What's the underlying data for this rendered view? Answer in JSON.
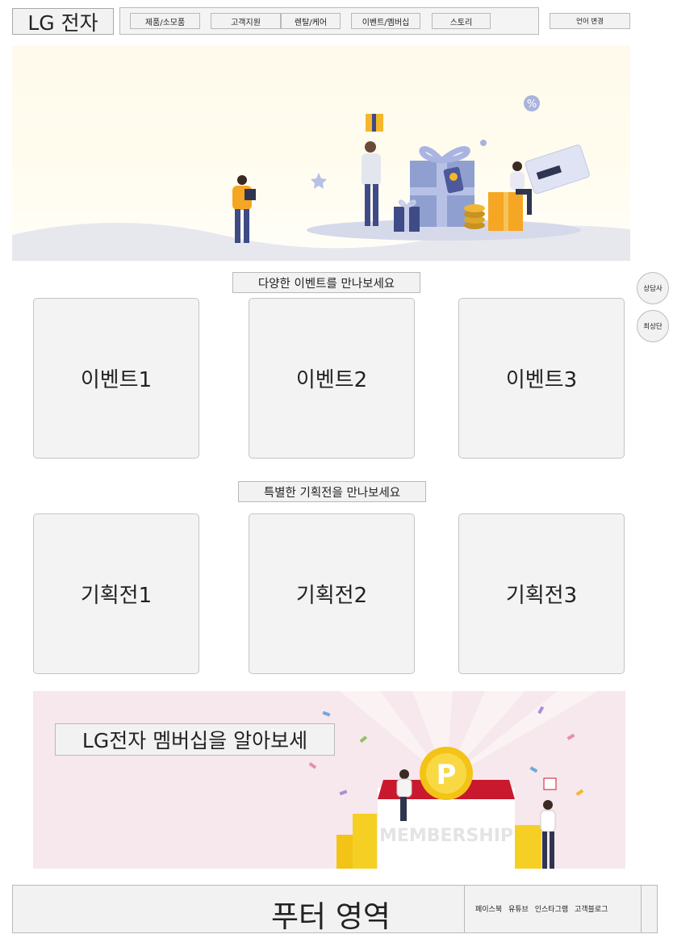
{
  "header": {
    "logo": "LG 전자",
    "nav": [
      "제품/소모품",
      "고객지원",
      "렌탈/케어",
      "이벤트/멤버십",
      "스토리"
    ],
    "language_button": "언어 변경"
  },
  "hero": {
    "image": "gift-event-illustration"
  },
  "floating": {
    "consult": "상담사",
    "top": "최상단"
  },
  "events": {
    "title": "다양한 이벤트를 만나보세요",
    "items": [
      "이벤트1",
      "이벤트2",
      "이벤트3"
    ]
  },
  "exhibitions": {
    "title": "특별한 기획전을 만나보세요",
    "items": [
      "기획전1",
      "기획전2",
      "기획전3"
    ]
  },
  "membership": {
    "title": "LG전자 멤버십을 알아보세",
    "banner_text": "MEMBERSHIP",
    "coin_letter": "P"
  },
  "footer": {
    "title": "푸터 영역",
    "links": [
      "페이스북",
      "유튜브",
      "인스타그램",
      "고객블로그"
    ]
  },
  "colors": {
    "hero_bg": "#fffaeb",
    "membership_bg": "#f6e8ec",
    "box_gray": "#f2f2f2",
    "border": "#b9b9b9"
  }
}
